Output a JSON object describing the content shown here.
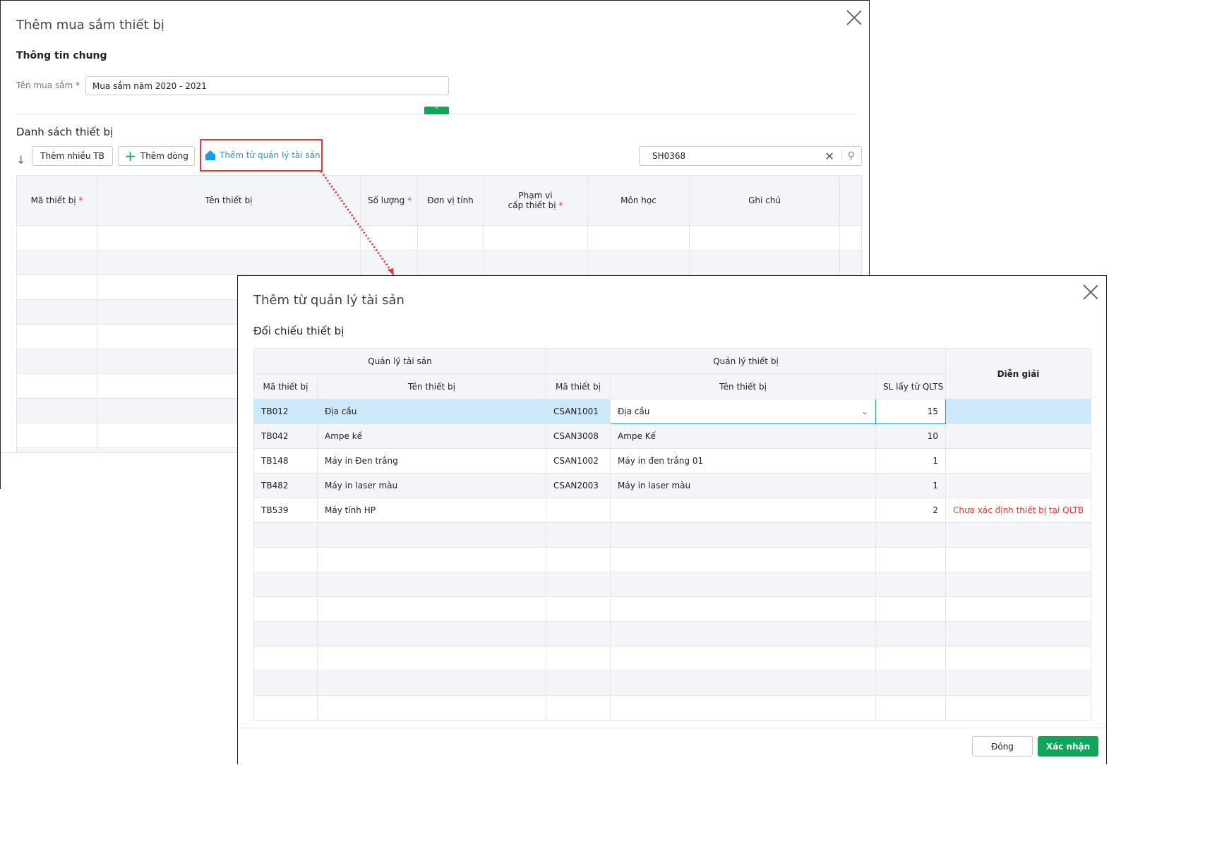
{
  "main": {
    "title": "Thêm mua sắm thiết bị",
    "section_general": "Thông tin chung",
    "name_label": "Tên mua sắm",
    "name_value": "Mua sắm năm 2020 - 2021",
    "section_list": "Danh sách thiết bị",
    "btn_add_many": "Thêm nhiều TB",
    "btn_add_row": "Thêm dòng",
    "btn_add_from_asset": "Thêm từ quản lý tài sản",
    "search_value": "SH0368",
    "columns": [
      "Mã thiết bị",
      "Tên thiết bị",
      "Số lượng",
      "Đơn vị tính",
      "Phạm vi",
      "cấp thiết bị",
      "Môn học",
      "Ghi chú"
    ]
  },
  "popup": {
    "title": "Thêm từ quản lý tài sản",
    "section": "Đối chiếu thiết bị",
    "group_asset": "Quản lý tài sản",
    "group_device": "Quản lý thiết bị",
    "col_note": "Diễn giải",
    "sub_cols": [
      "Mã thiết bị",
      "Tên thiết bị",
      "Mã thiết bị",
      "Tên thiết bị",
      "SL lấy từ QLTS"
    ],
    "rows": [
      {
        "asset_code": "TB012",
        "asset_name": "Địa cầu",
        "device_code": "CSAN1001",
        "device_name": "Địa cầu",
        "qty": "15",
        "note": ""
      },
      {
        "asset_code": "TB042",
        "asset_name": "Ampe kế",
        "device_code": "CSAN3008",
        "device_name": "Ampe Kế",
        "qty": "10",
        "note": ""
      },
      {
        "asset_code": "TB148",
        "asset_name": "Máy in Đen trắng",
        "device_code": "CSAN1002",
        "device_name": "Máy in đen trắng 01",
        "qty": "1",
        "note": ""
      },
      {
        "asset_code": "TB482",
        "asset_name": "Máy in laser màu",
        "device_code": "CSAN2003",
        "device_name": "Máy in laser màu",
        "qty": "1",
        "note": ""
      },
      {
        "asset_code": "TB539",
        "asset_name": "Máy tính HP",
        "device_code": "",
        "device_name": "",
        "qty": "2",
        "note": "Chưa xác định thiết bị tại QLTB"
      }
    ],
    "btn_close": "Đóng",
    "btn_confirm": "Xác nhận"
  },
  "colors": {
    "accent": "#1e9be9",
    "green": "#0fa65a",
    "red": "#e53935",
    "selected": "#cce8fb"
  }
}
